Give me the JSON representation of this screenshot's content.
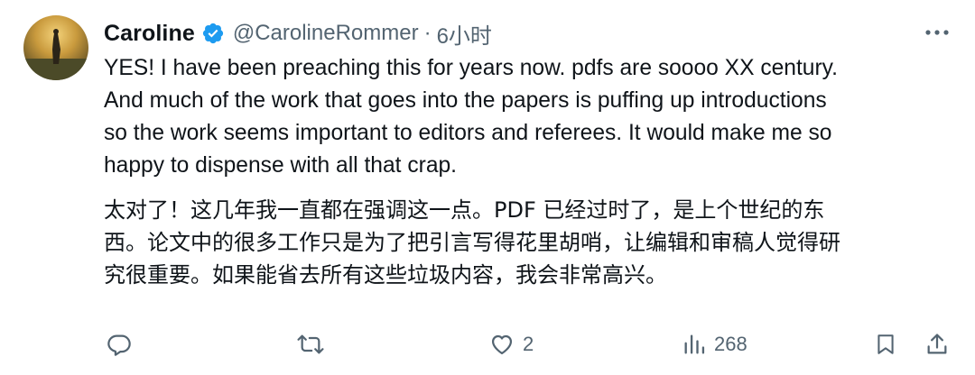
{
  "tweet": {
    "author": {
      "display_name": "Caroline",
      "handle": "@CarolineRommer",
      "separator": "·",
      "time": "6小时",
      "verified": true,
      "verified_color": "#1d9bf0"
    },
    "text_en": "YES! I have been preaching this for years now. pdfs are soooo XX century.\nAnd much of the work that goes into the papers is puffing up introductions\nso the work seems important to editors and referees. It would make me so\nhappy to dispense with all that crap.",
    "text_zh": "太对了！这几年我一直都在强调这一点。PDF 已经过时了，是上个世纪的东\n西。论文中的很多工作只是为了把引言写得花里胡哨，让编辑和审稿人觉得研\n究很重要。如果能省去所有这些垃圾内容，我会非常高兴。",
    "actions": {
      "reply": {
        "icon": "reply-icon",
        "count": ""
      },
      "retweet": {
        "icon": "retweet-icon",
        "count": ""
      },
      "like": {
        "icon": "heart-icon",
        "count": "2"
      },
      "views": {
        "icon": "views-icon",
        "count": "268"
      },
      "bookmark": {
        "icon": "bookmark-icon"
      },
      "share": {
        "icon": "share-icon"
      }
    },
    "icon_color": "#536471"
  }
}
